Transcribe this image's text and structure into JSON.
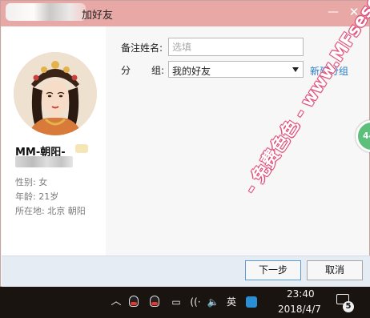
{
  "dialog": {
    "title_partial": "加好友",
    "minimize_glyph": "—",
    "close_glyph": "✕"
  },
  "profile": {
    "nickname": "MM-朝阳-",
    "gender": "性别: 女",
    "age": "年龄: 21岁",
    "location": "所在地: 北京  朝阳"
  },
  "form": {
    "remark_label": "备注姓名:",
    "remark_placeholder": "选填",
    "group_label_a": "分",
    "group_label_b": "组:",
    "group_value": "我的好友",
    "new_group_link": "新建分组"
  },
  "buttons": {
    "next": "下一步",
    "cancel": "取消"
  },
  "floating_bubble": {
    "label": "44"
  },
  "taskbar": {
    "chevron": "︿",
    "battery": "▭",
    "wifi": "((·",
    "volume": "🔈",
    "ime": "英",
    "time": "23:40",
    "date": "2018/4/7",
    "notification_count": "5"
  },
  "watermark": {
    "text": "- 免费色色 - www.MFsese.com"
  }
}
